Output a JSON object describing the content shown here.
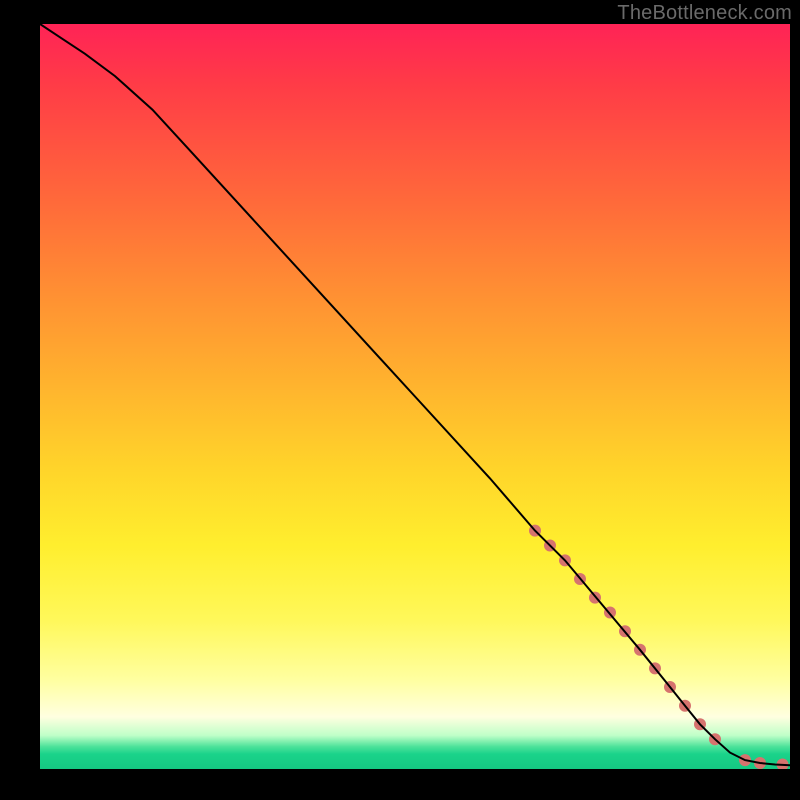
{
  "watermark": "TheBottleneck.com",
  "chart_data": {
    "type": "line",
    "title": "",
    "xlabel": "",
    "ylabel": "",
    "xlim": [
      0,
      100
    ],
    "ylim": [
      0,
      100
    ],
    "grid": false,
    "legend": false,
    "gradient_stops": [
      {
        "pos": 0,
        "color": "#ff2356"
      },
      {
        "pos": 0.08,
        "color": "#ff3b47"
      },
      {
        "pos": 0.24,
        "color": "#ff6a3a"
      },
      {
        "pos": 0.36,
        "color": "#ff8f33"
      },
      {
        "pos": 0.48,
        "color": "#ffb22e"
      },
      {
        "pos": 0.6,
        "color": "#ffd52a"
      },
      {
        "pos": 0.7,
        "color": "#ffee2e"
      },
      {
        "pos": 0.8,
        "color": "#fff85a"
      },
      {
        "pos": 0.88,
        "color": "#ffffa0"
      },
      {
        "pos": 0.93,
        "color": "#ffffe0"
      },
      {
        "pos": 0.955,
        "color": "#bfffc8"
      },
      {
        "pos": 0.97,
        "color": "#4de29a"
      },
      {
        "pos": 0.98,
        "color": "#1ad38a"
      },
      {
        "pos": 1.0,
        "color": "#15c882"
      }
    ],
    "series": [
      {
        "name": "curve",
        "color": "#000000",
        "stroke_width": 2,
        "x": [
          0,
          3,
          6,
          10,
          15,
          20,
          30,
          40,
          50,
          60,
          66,
          70,
          75,
          80,
          84,
          86,
          88,
          90,
          92,
          94,
          96,
          98,
          100
        ],
        "y": [
          100,
          98,
          96,
          93,
          88.5,
          83,
          72,
          61,
          50,
          39,
          32,
          28,
          22,
          16,
          11,
          8.5,
          6,
          4,
          2.2,
          1.2,
          0.8,
          0.6,
          0.5
        ]
      },
      {
        "name": "highlight-dots",
        "color": "#d6736e",
        "marker_radius": 6,
        "x": [
          66,
          68,
          70,
          72,
          74,
          76,
          78,
          80,
          82,
          84,
          86,
          88,
          90,
          94,
          96,
          99
        ],
        "y": [
          32,
          30,
          28,
          25.5,
          23,
          21,
          18.5,
          16,
          13.5,
          11,
          8.5,
          6,
          4,
          1.2,
          0.8,
          0.6
        ]
      }
    ]
  }
}
